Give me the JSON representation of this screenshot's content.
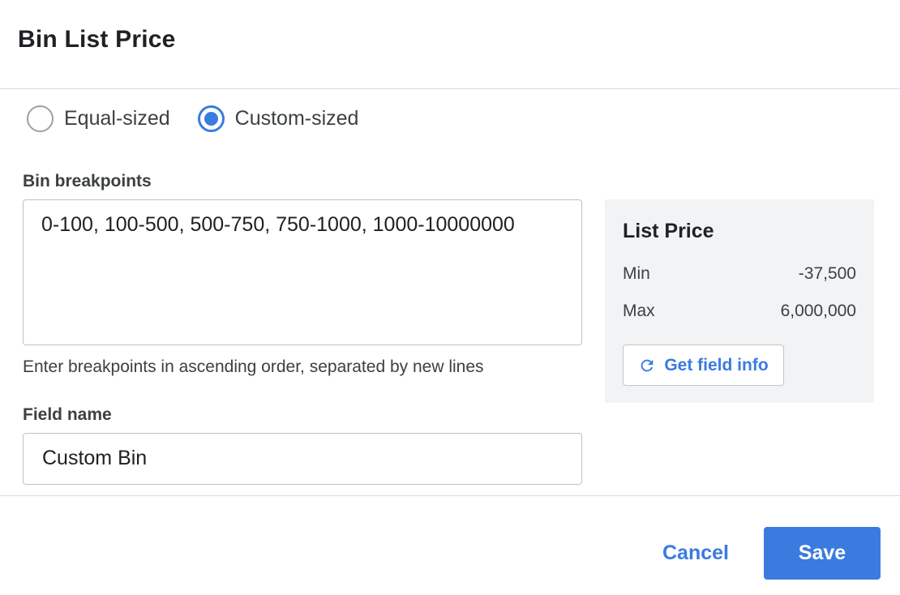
{
  "dialog": {
    "title": "Bin List Price"
  },
  "bin_type": {
    "options": [
      {
        "label": "Equal-sized",
        "checked": false
      },
      {
        "label": "Custom-sized",
        "checked": true
      }
    ]
  },
  "breakpoints": {
    "label": "Bin breakpoints",
    "value": "0-100, 100-500, 500-750, 750-1000, 1000-10000000",
    "helper": "Enter breakpoints in ascending order, separated by new lines"
  },
  "field_name": {
    "label": "Field name",
    "value": "Custom Bin"
  },
  "field_info": {
    "title": "List Price",
    "min_label": "Min",
    "min_value": "-37,500",
    "max_label": "Max",
    "max_value": "6,000,000",
    "button_label": "Get field info",
    "button_icon": "refresh-icon"
  },
  "footer": {
    "cancel_label": "Cancel",
    "save_label": "Save"
  },
  "colors": {
    "accent": "#3a7be0",
    "panel_bg": "#f1f3f4"
  }
}
